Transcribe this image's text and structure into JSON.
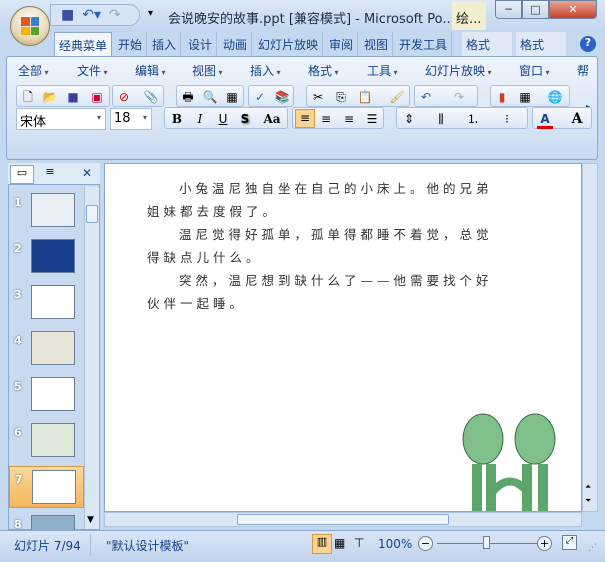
{
  "window": {
    "title": "会说晚安的故事.ppt [兼容模式] - Microsoft Po...",
    "context_tab": "绘...",
    "minimize": "─",
    "maximize": "□",
    "close": "✕"
  },
  "tabs": [
    "经典菜单",
    "开始",
    "插入",
    "设计",
    "动画",
    "幻灯片放映",
    "审阅",
    "视图",
    "开发工具",
    "格式",
    "格式"
  ],
  "menus": [
    "全部",
    "文件",
    "编辑",
    "视图",
    "插入",
    "格式",
    "工具",
    "幻灯片放映",
    "窗口",
    "帮"
  ],
  "font": {
    "name": "宋体",
    "size": "18"
  },
  "format_buttons": {
    "bold": "B",
    "italic": "I",
    "underline": "U",
    "shadow": "S",
    "change_case": "Aa",
    "font_color": "A",
    "grow": "A"
  },
  "panel_tabs": {
    "slides": "▭",
    "outline": "≡",
    "close": "✕"
  },
  "thumbnails": [
    {
      "n": "1"
    },
    {
      "n": "2"
    },
    {
      "n": "3"
    },
    {
      "n": "4"
    },
    {
      "n": "5"
    },
    {
      "n": "6"
    },
    {
      "n": "7",
      "selected": true
    },
    {
      "n": "8"
    }
  ],
  "slide_text": [
    "小兔温尼独自坐在自己的小床上。他的兄弟",
    "姐妹都去度假了。",
    "温尼觉得好孤单，孤单得都睡不着觉，总觉",
    "得缺点儿什么。",
    "突然，温尼想到缺什么了——他需要找个好",
    "伙伴一起睡。"
  ],
  "status": {
    "slide": "幻灯片 7/94",
    "theme": "\"默认设计模板\"",
    "zoom": "100%",
    "zoom_fraction": 0.5
  },
  "colors": {
    "accent": "#15428b",
    "selected": "#f6b55c",
    "font_color_bar": "#e00000"
  }
}
